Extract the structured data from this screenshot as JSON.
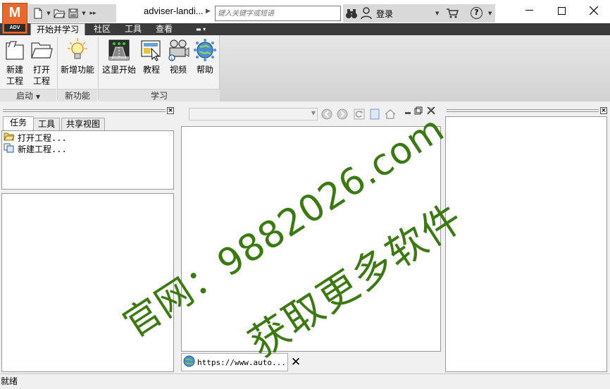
{
  "app": {
    "logo_letter": "M",
    "logo_badge": "ADV",
    "brand_color": "#e8692e",
    "document_title": "adviser-landi..."
  },
  "search": {
    "placeholder": "键入关键字或短语"
  },
  "account": {
    "login_label": "登录"
  },
  "ribbon": {
    "tabs": [
      {
        "label": "开始并学习",
        "active": true
      },
      {
        "label": "社区",
        "active": false
      },
      {
        "label": "工具",
        "active": false
      },
      {
        "label": "查看",
        "active": false
      }
    ],
    "panels": {
      "startup": {
        "label": "启动",
        "buttons": [
          {
            "label_line1": "新建",
            "label_line2": "工程",
            "icon": "new-project-icon"
          },
          {
            "label_line1": "打开",
            "label_line2": "工程",
            "icon": "open-project-icon"
          }
        ]
      },
      "new_features": {
        "label": "新功能",
        "buttons": [
          {
            "label": "新增功能",
            "icon": "lightbulb-icon"
          }
        ]
      },
      "learn": {
        "label": "学习",
        "buttons": [
          {
            "label": "这里开始",
            "icon": "start-here-icon"
          },
          {
            "label": "教程",
            "icon": "tutorial-icon"
          },
          {
            "label": "视频",
            "icon": "video-icon"
          },
          {
            "label": "帮助",
            "icon": "help-globe-icon"
          }
        ]
      }
    }
  },
  "left_pane": {
    "tabs": [
      {
        "label": "任务",
        "active": true
      },
      {
        "label": "工具",
        "active": false
      },
      {
        "label": "共享视图",
        "active": false
      }
    ],
    "tasks": [
      {
        "label": "打开工程...",
        "icon": "open-folder-icon"
      },
      {
        "label": "新建工程...",
        "icon": "new-project-small-icon"
      }
    ]
  },
  "browser": {
    "doc_tab_label": "https://www.auto...",
    "doc_tab_icon": "globe-icon"
  },
  "watermark": {
    "line1": "官网：9882026.com",
    "line2": "获取更多软件"
  },
  "status": {
    "text": "就绪"
  }
}
